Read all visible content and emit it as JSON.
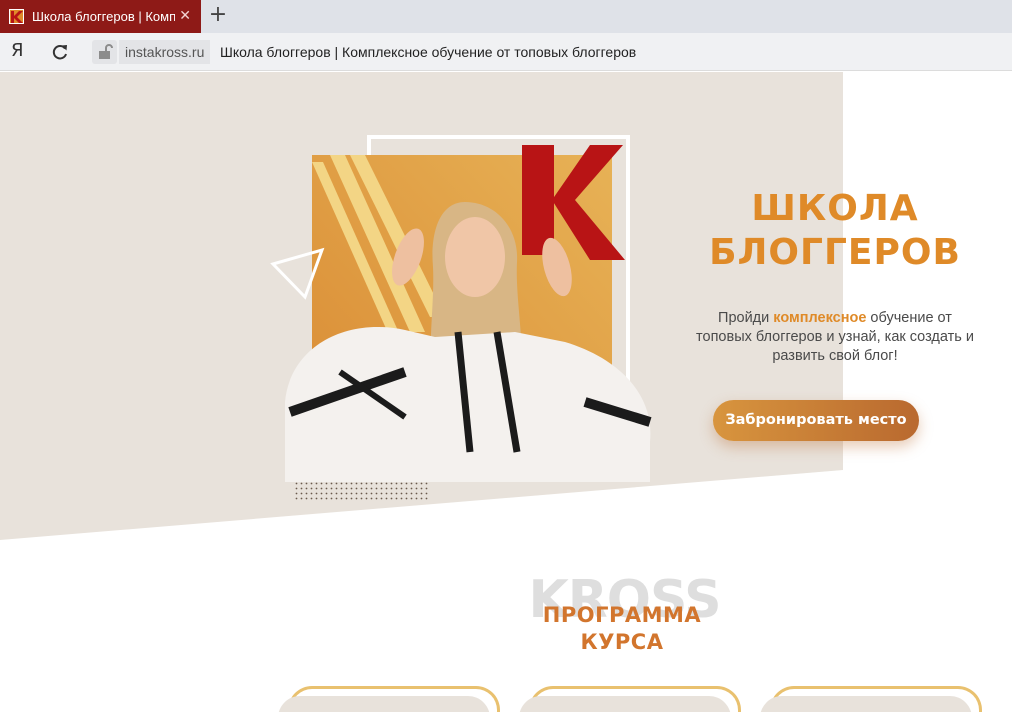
{
  "browser": {
    "tab": {
      "title": "Школа блоггеров | Комплексное обучение от топовых блоггеров",
      "close": "✕"
    },
    "new_tab": "+",
    "yandex_label": "Я",
    "domain": "instakross.ru",
    "page_title": "Школа блоггеров | Комплексное обучение от топовых блоггеров"
  },
  "hero": {
    "logo_letter": "K",
    "title_line1": "ШКОЛА",
    "title_line2": "БЛОГГЕРОВ",
    "text_before": "Пройди ",
    "text_highlight": "комплексное",
    "text_after": " обучение от топовых блоггеров и узнай, как создать и развить свой блог!",
    "cta_label": "Забронировать место"
  },
  "program": {
    "watermark": "KROSS",
    "title_line1": "ПРОГРАММА",
    "title_line2": "КУРСА",
    "cards_count": 3
  },
  "colors": {
    "accent_orange": "#df8a28",
    "tab_red": "#8e1a17",
    "logo_red": "#b81415",
    "hero_bg": "#e8e2db",
    "card_border": "#e9c16f"
  },
  "icons": [
    "yandex-icon",
    "reload-icon",
    "lock-icon",
    "close-icon",
    "plus-icon"
  ]
}
